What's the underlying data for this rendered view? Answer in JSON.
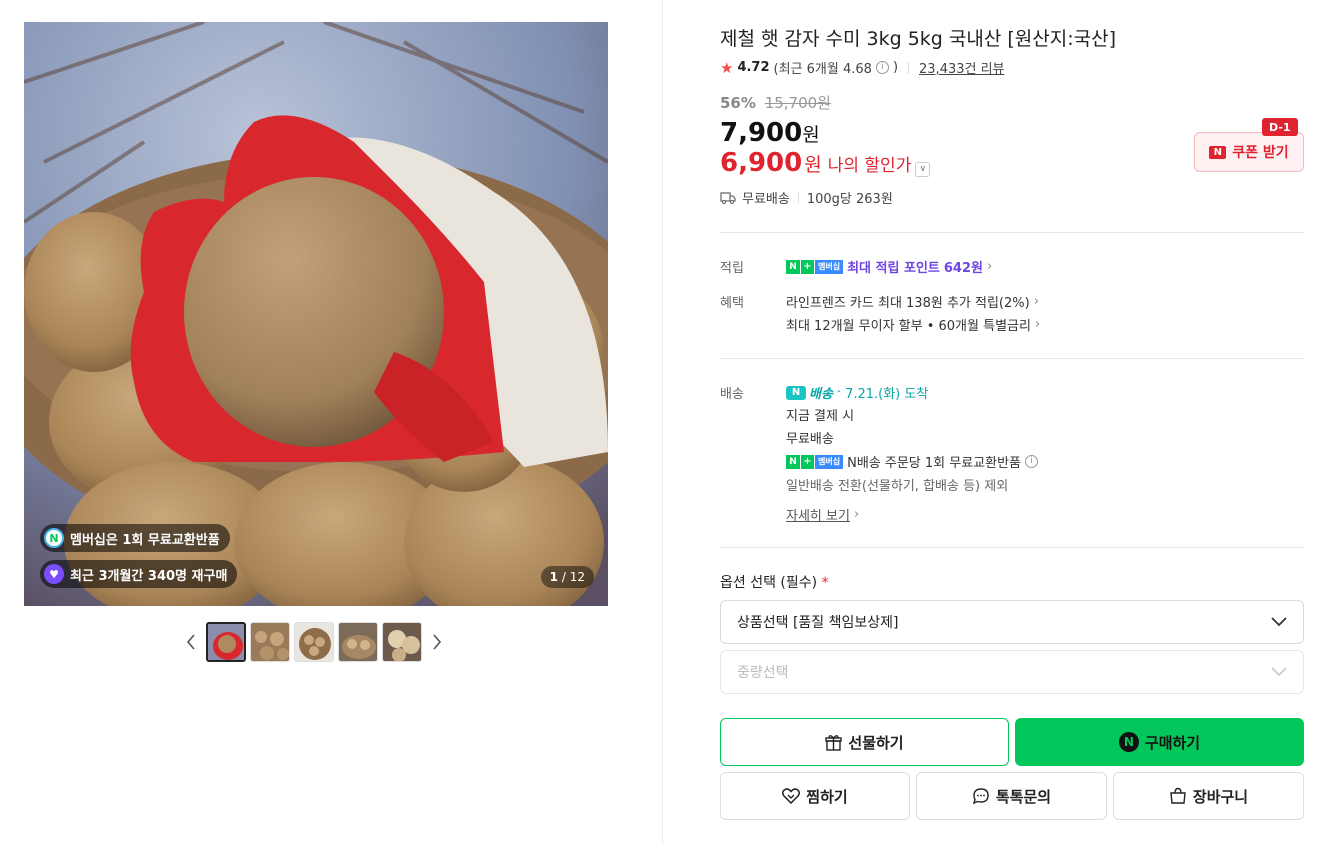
{
  "product": {
    "title": "제철 햇 감자 수미 3kg 5kg 국내산 [원산지:국산]",
    "rating": "4.72",
    "recent_rating": "(최근 6개월 4.68",
    "recent_rating_close": ")",
    "review_count": "23,433건 리뷰"
  },
  "price": {
    "discount_pct": "56%",
    "original": "15,700원",
    "sale": "7,900",
    "sale_unit": "원",
    "my_price": "6,900",
    "my_unit": "원",
    "my_label": "나의 할인가"
  },
  "coupon": {
    "label": "쿠폰 받기",
    "dday": "D-1",
    "logo": "N"
  },
  "shipping_summary": {
    "free": "무료배송",
    "unit_price": "100g당 263원"
  },
  "benefits": {
    "points_label": "적립",
    "points_text": "최대 적립 포인트",
    "points_value": "642원",
    "benefit_label": "혜택",
    "line1": "라인프렌즈 카드 최대 138원 추가 적립(2%)",
    "line2": "최대 12개월 무이자 할부 • 60개월 특별금리",
    "membership_badge": "멤버십"
  },
  "delivery": {
    "label": "배송",
    "n_ship": "배송",
    "dot": "·",
    "arrive": "7.21.(화) 도착",
    "line1": "지금 결제 시",
    "line2": "무료배송",
    "line3": "N배송 주문당 1회 무료교환반품",
    "line4": "일반배송 전환(선물하기, 합배송 등) 제외",
    "more": "자세히 보기"
  },
  "options": {
    "label": "옵션 선택 (필수)",
    "required_mark": "*",
    "select1": "상품선택 [품질 책임보상제]",
    "select2": "중량선택"
  },
  "buttons": {
    "gift": "선물하기",
    "buy": "구매하기",
    "wish": "찜하기",
    "talk": "톡톡문의",
    "cart": "장바구니"
  },
  "gallery": {
    "badge1": "멤버십은 1회 무료교환반품",
    "badge2": "최근 3개월간 340명 재구매",
    "current": "1",
    "total": "/ 12"
  },
  "colors": {
    "accent_green": "#03c75a",
    "price_red": "#e0242f",
    "membership_purple": "#6e45e2",
    "delivery_teal": "#0aa5a6"
  },
  "icons": [
    "star-icon",
    "info-icon",
    "truck-icon",
    "chevron-right-icon",
    "chevron-down-icon",
    "gift-icon",
    "heart-icon",
    "chat-icon",
    "bag-icon",
    "n-logo-icon"
  ]
}
